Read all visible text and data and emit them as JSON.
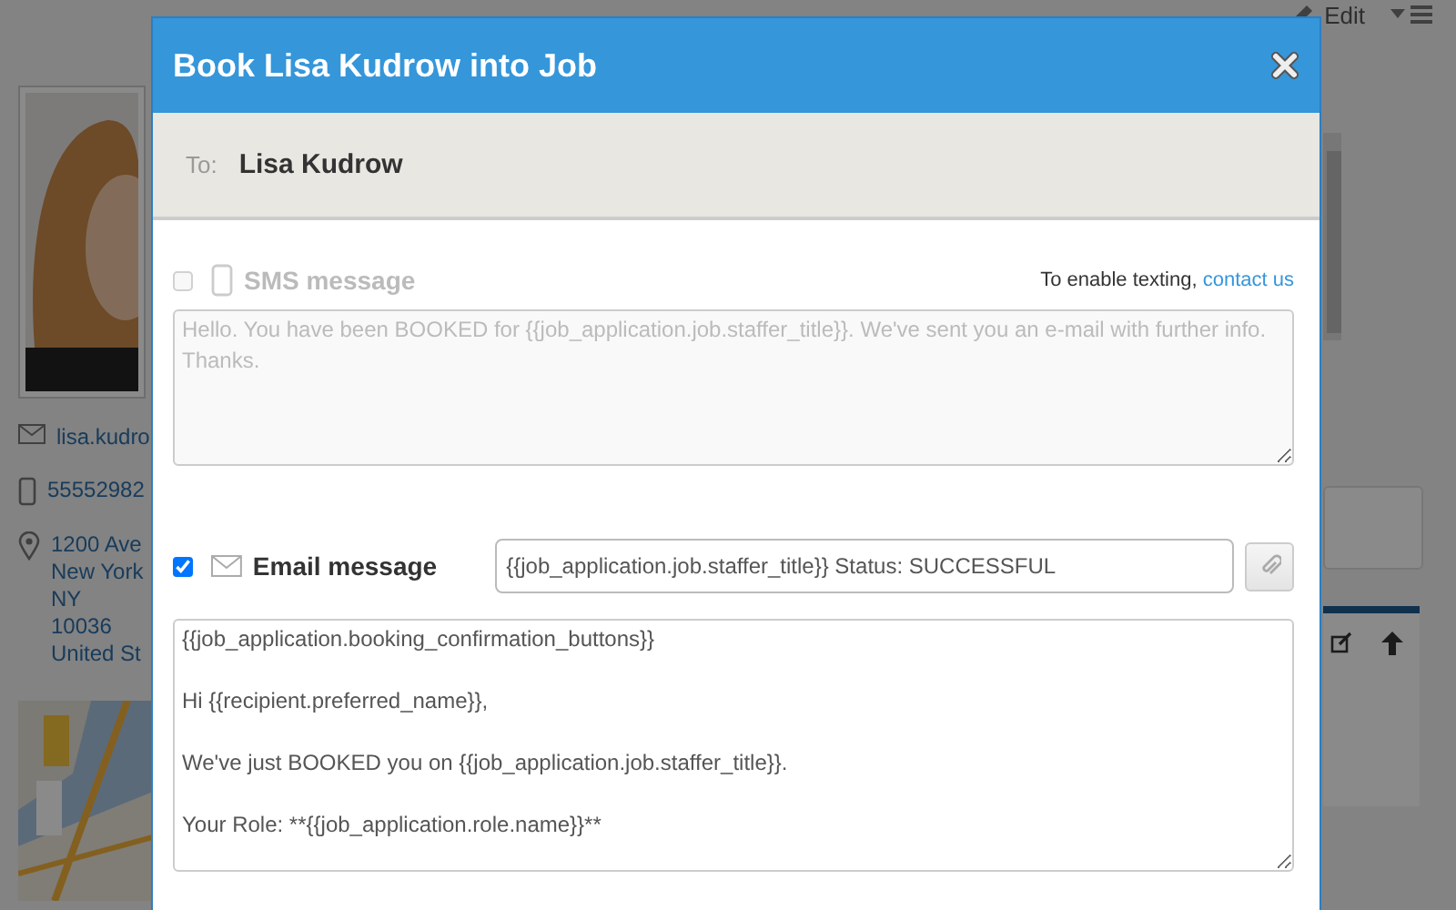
{
  "background_page": {
    "toolbar": [
      {
        "kind": "edit",
        "label": "Edit"
      }
    ],
    "contact": {
      "email": "lisa.kudro",
      "phone": "55552982",
      "address": [
        "1200 Ave",
        "New York",
        "NY",
        "10036",
        "United St"
      ]
    }
  },
  "modal": {
    "title": "Book Lisa Kudrow into Job",
    "to_label": "To:",
    "recipient": "Lisa Kudrow",
    "sms": {
      "label": "SMS message",
      "checked": false,
      "disabled": true,
      "notice": "To enable texting,",
      "notice_link": "contact us",
      "message": "Hello. You have been BOOKED for {{job_application.job.staffer_title}}. We've sent you an e-mail with further info. Thanks."
    },
    "email": {
      "label": "Email message",
      "checked": true,
      "subject": "{{job_application.job.staffer_title}} Status: SUCCESSFUL",
      "body": [
        "{{job_application.booking_confirmation_buttons}}",
        "Hi {{recipient.preferred_name}},",
        "We've just BOOKED you on {{job_application.job.staffer_title}}.",
        "Your Role: **{{job_application.role.name}}**"
      ]
    }
  }
}
